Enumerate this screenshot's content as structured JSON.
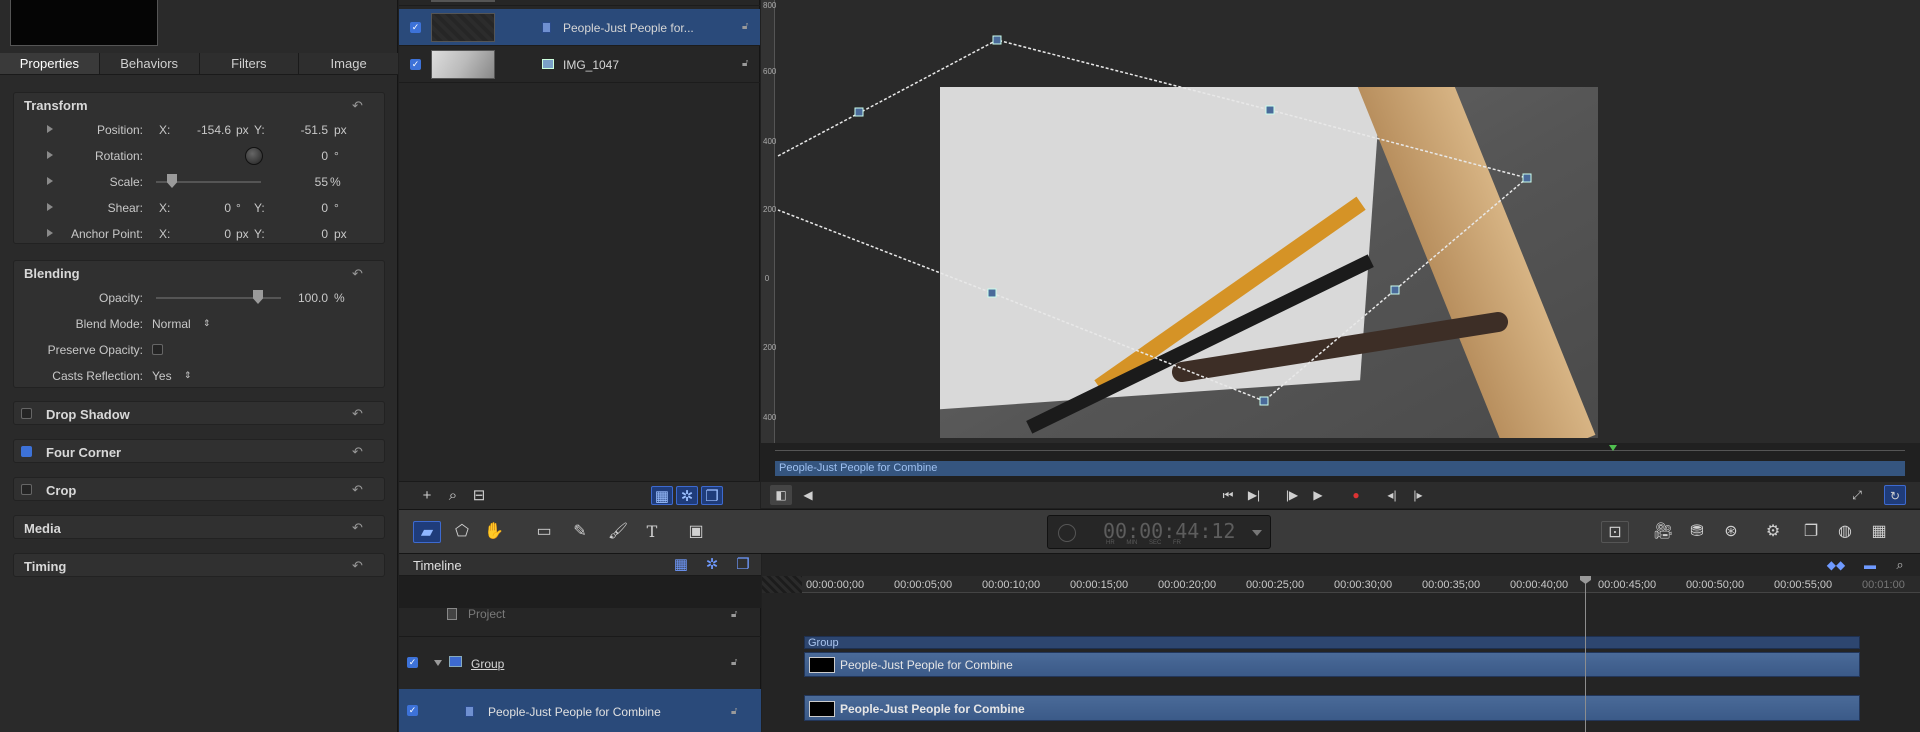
{
  "inspector": {
    "tabs": [
      "Properties",
      "Behaviors",
      "Filters",
      "Image"
    ],
    "transform": {
      "title": "Transform",
      "position": {
        "label": "Position:",
        "x_label": "X:",
        "x": "-154.6",
        "x_unit": "px",
        "y_label": "Y:",
        "y": "-51.5",
        "y_unit": "px"
      },
      "rotation": {
        "label": "Rotation:",
        "value": "0",
        "unit": "°"
      },
      "scale": {
        "label": "Scale:",
        "value": "55",
        "unit": "%",
        "level": 0.15
      },
      "shear": {
        "label": "Shear:",
        "x_label": "X:",
        "x": "0",
        "x_unit": "°",
        "y_label": "Y:",
        "y": "0",
        "y_unit": "°"
      },
      "anchor": {
        "label": "Anchor Point:",
        "x_label": "X:",
        "x": "0",
        "x_unit": "px",
        "y_label": "Y:",
        "y": "0",
        "y_unit": "px"
      }
    },
    "blending": {
      "title": "Blending",
      "opacity": {
        "label": "Opacity:",
        "value": "100.0",
        "unit": "%",
        "level": 1.0
      },
      "blend_mode": {
        "label": "Blend Mode:",
        "value": "Normal"
      },
      "preserve_opacity": {
        "label": "Preserve Opacity:",
        "checked": false
      },
      "casts_reflection": {
        "label": "Casts Reflection:",
        "value": "Yes"
      }
    },
    "collapsed_sections": [
      {
        "title": "Drop Shadow",
        "enabled": false
      },
      {
        "title": "Four Corner",
        "enabled": true
      },
      {
        "title": "Crop",
        "enabled": false
      },
      {
        "title": "Media"
      },
      {
        "title": "Timing"
      }
    ]
  },
  "layers": {
    "items": [
      {
        "name": "People-Just People for...",
        "selected": true
      },
      {
        "name": "IMG_1047",
        "selected": false
      }
    ]
  },
  "canvas": {
    "ruler_ticks": [
      "800",
      "600",
      "400",
      "200",
      "0",
      "200",
      "400"
    ],
    "mini_timeline_label": "People-Just People for Combine"
  },
  "timecode": {
    "value": "00:00:44:12",
    "units": "HR MIN SEC FR"
  },
  "timeline": {
    "title": "Timeline",
    "ruler_labels": [
      "00:00:00;00",
      "00:00:05;00",
      "00:00:10;00",
      "00:00:15;00",
      "00:00:20;00",
      "00:00:25;00",
      "00:00:30;00",
      "00:00:35;00",
      "00:00:40;00",
      "00:00:45;00",
      "00:00:50;00",
      "00:00:55;00",
      "00:01:00"
    ],
    "project_label": "Project",
    "group_label": "Group",
    "layer_label": "People-Just People for Combine",
    "group_bar_label": "Group",
    "clip1_label": "People-Just People for Combine",
    "clip2_label": "People-Just People for Combine"
  },
  "colors": {
    "accent": "#3d72d8",
    "clip": "#3b5a88",
    "selection": "#2a4a7a"
  }
}
